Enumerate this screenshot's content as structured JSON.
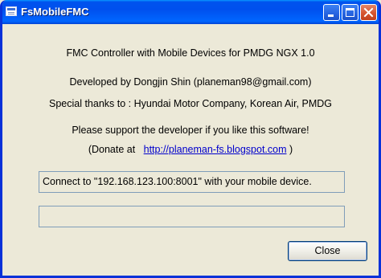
{
  "window": {
    "title": "FsMobileFMC",
    "icon": "app-window-icon"
  },
  "about": {
    "line1": "FMC Controller with Mobile Devices for PMDG NGX 1.0",
    "line2": "Developed by Dongjin Shin (planeman98@gmail.com)",
    "line3": "Special thanks to : Hyundai Motor Company, Korean Air, PMDG",
    "line4": "Please support the developer if you like this software!",
    "donate_prefix": "(Donate at",
    "donate_link": "http://planeman-fs.blogspot.com",
    "donate_suffix": ")"
  },
  "status": {
    "message": "Connect to \"192.168.123.100:8001\" with your mobile device.",
    "secondary": ""
  },
  "buttons": {
    "close_label": "Close"
  },
  "colors": {
    "titlebar": "#0054e3",
    "window_bg": "#ece9d8",
    "link": "#0000cc",
    "field_border": "#7f9db9"
  }
}
